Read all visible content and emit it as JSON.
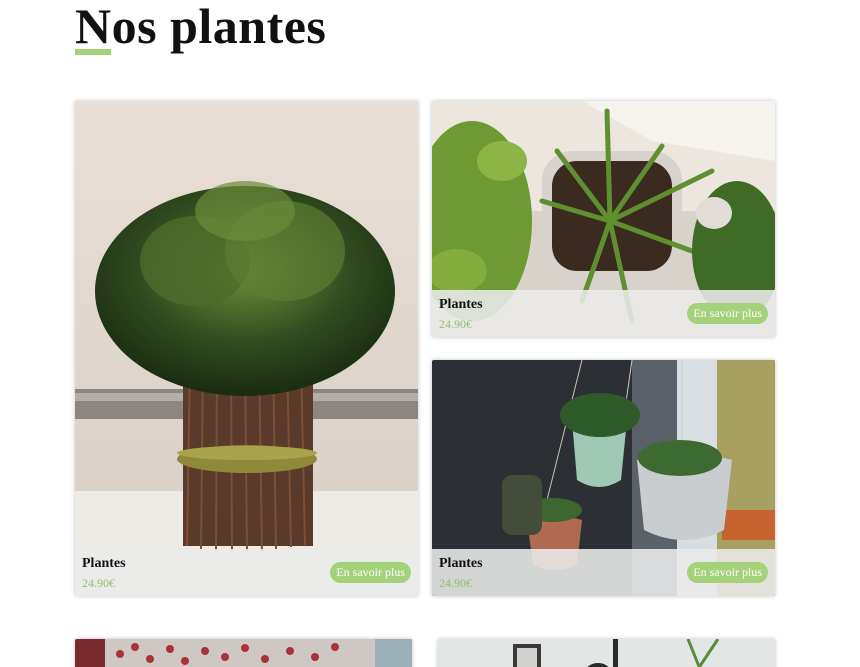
{
  "page": {
    "title": "Nos plantes"
  },
  "colors": {
    "accent": "#a3d27a",
    "price": "#8fbf6a"
  },
  "cards": [
    {
      "name": "Plantes",
      "price": "24.90€",
      "button": "En savoir plus",
      "image": "boxwood-bundle"
    },
    {
      "name": "Plantes",
      "price": "24.90€",
      "button": "En savoir plus",
      "image": "potted-spider-plant-and-pothos"
    },
    {
      "name": "Plantes",
      "price": "24.90€",
      "button": "En savoir plus",
      "image": "hanging-macrame-planters"
    },
    {
      "image": "red-berry-branches"
    },
    {
      "image": "wall-frames-and-plant"
    }
  ]
}
